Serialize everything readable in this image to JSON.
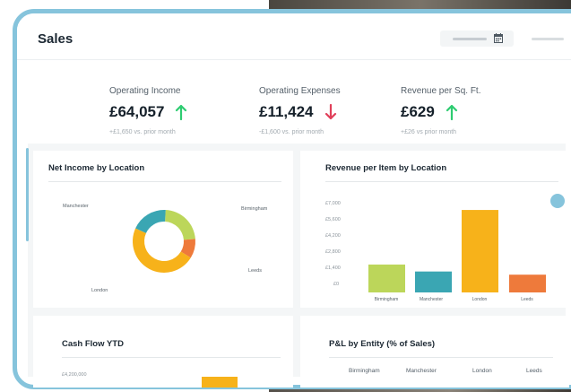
{
  "app": {
    "title": "Sales"
  },
  "colors": {
    "accent": "#86c4dc",
    "up": "#2ecc71",
    "down": "#e0405a",
    "lime": "#bcd65a",
    "teal": "#3aa6b3",
    "yellow": "#f7b21a",
    "orange": "#ee7a3b"
  },
  "kpis": [
    {
      "label": "Operating Income",
      "value": "£64,057",
      "trend": "up",
      "sub": "+£1,650 vs. prior month"
    },
    {
      "label": "Operating Expenses",
      "value": "£11,424",
      "trend": "down",
      "sub": "-£1,600 vs. prior month"
    },
    {
      "label": "Revenue per Sq. Ft.",
      "value": "£629",
      "trend": "up",
      "sub": "+£26 vs prior month"
    }
  ],
  "net_income": {
    "title": "Net Income by Location",
    "labels": {
      "manchester": "Manchester",
      "birmingham": "Birmingham",
      "leeds": "Leeds",
      "london": "London"
    }
  },
  "revenue_per_item": {
    "title": "Revenue per Item by Location",
    "ticks": [
      "£7,000",
      "£5,600",
      "£4,200",
      "£2,800",
      "£1,400",
      "£0"
    ]
  },
  "cash_flow": {
    "title": "Cash Flow YTD",
    "tick": "£4,200,000"
  },
  "pl": {
    "title": "P&L by Entity (% of Sales)",
    "columns": [
      "Birmingham",
      "Manchester",
      "London",
      "Leeds"
    ]
  },
  "chart_data": [
    {
      "type": "pie",
      "title": "Net Income by Location",
      "categories": [
        "Birmingham",
        "Leeds",
        "London",
        "Manchester"
      ],
      "values": [
        23,
        10,
        48,
        19
      ]
    },
    {
      "type": "bar",
      "title": "Revenue per Item by Location",
      "categories": [
        "Birmingham",
        "Manchester",
        "London",
        "Leeds"
      ],
      "values": [
        2200,
        1650,
        6500,
        1400
      ],
      "ylim": [
        0,
        7000
      ]
    }
  ]
}
